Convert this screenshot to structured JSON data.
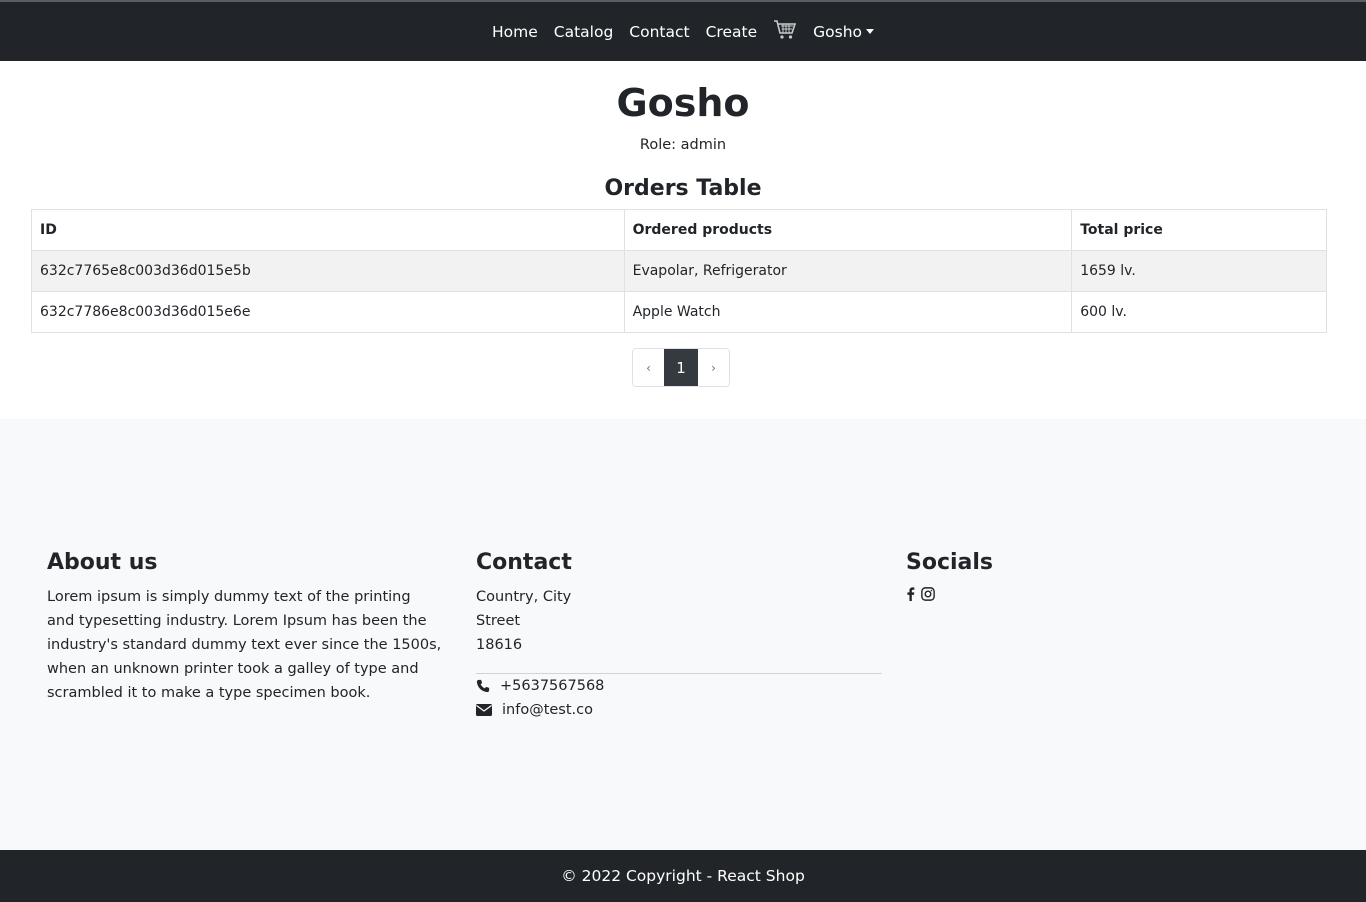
{
  "navbar": {
    "items": [
      "Home",
      "Catalog",
      "Contact",
      "Create"
    ],
    "cart_icon": "cart-icon",
    "user_menu_label": "Gosho"
  },
  "profile": {
    "name": "Gosho",
    "role_label": "Role:",
    "role_value": "admin"
  },
  "orders": {
    "title": "Orders Table",
    "headers": [
      "ID",
      "Ordered products",
      "Total price"
    ],
    "rows": [
      [
        "632c7765e8c003d36d015e5b",
        "Evapolar, Refrigerator",
        "1659 lv."
      ],
      [
        "632c7786e8c003d36d015e6e",
        "Apple Watch",
        "600 lv."
      ]
    ]
  },
  "pagination": {
    "prev_label": "‹",
    "current_page": "1",
    "next_label": "›"
  },
  "footer": {
    "about": {
      "title": "About us",
      "text": "Lorem ipsum is simply dummy text of the printing and typesetting industry. Lorem Ipsum has been the industry's standard dummy text ever since the 1500s, when an unknown printer took a galley of type and scrambled it to make a type specimen book."
    },
    "contact": {
      "title": "Contact",
      "lines": [
        "Country, City",
        "Street",
        "18616"
      ],
      "phone": "+5637567568",
      "email": "info@test.co"
    },
    "socials": {
      "title": "Socials",
      "icons": [
        "facebook-icon",
        "instagram-icon"
      ]
    },
    "copyright": "© 2022 Copyright - React Shop"
  },
  "colors": {
    "navbar_bg": "#212529",
    "footer_bg": "#f8f9fa",
    "active_page": "#343a40"
  }
}
